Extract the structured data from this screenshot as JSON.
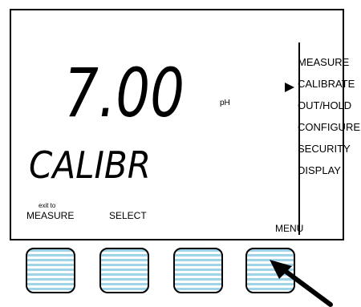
{
  "display": {
    "reading_value": "7.00",
    "unit": "pH",
    "mode_text": "CALIBR"
  },
  "menu": {
    "items": [
      {
        "label": "MEASURE"
      },
      {
        "label": "CALIBRATE",
        "selected": true
      },
      {
        "label": "OUT/HOLD"
      },
      {
        "label": "CONFIGURE"
      },
      {
        "label": "SECURITY"
      },
      {
        "label": "DISPLAY"
      }
    ]
  },
  "softkeys": {
    "key1_small": "exit to",
    "key1_label": "MEASURE",
    "key2_label": "SELECT",
    "key4_label": "MENU"
  },
  "icons": {
    "pointer": "triangle-right-icon",
    "press": "arrow-pointing-icon"
  },
  "colors": {
    "key_stripe": "#9ed3e8",
    "outline": "#000000"
  }
}
